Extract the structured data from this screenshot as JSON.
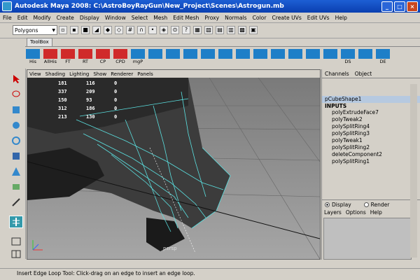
{
  "window": {
    "title": "Autodesk Maya 2008: C:\\AstroBoyRayGun\\New_Project\\Scenes\\Astrogun.mb"
  },
  "menubar": [
    "File",
    "Edit",
    "Modify",
    "Create",
    "Display",
    "Window",
    "Select",
    "Mesh",
    "Edit Mesh",
    "Proxy",
    "Normals",
    "Color",
    "Create UVs",
    "Edit UVs",
    "Help"
  ],
  "mode_select": {
    "value": "Polygons"
  },
  "shelf_tab": "ToolBox",
  "shelf_buttons": [
    {
      "label": "His",
      "color": "#1e7fc8"
    },
    {
      "label": "AllHis",
      "color": "#d02a2a"
    },
    {
      "label": "FT",
      "color": "#d02a2a"
    },
    {
      "label": "RT",
      "color": "#d02a2a"
    },
    {
      "label": "CP",
      "color": "#d02a2a"
    },
    {
      "label": "CPD",
      "color": "#d02a2a"
    },
    {
      "label": "mgP",
      "color": "#1e7fc8"
    },
    {
      "label": "",
      "color": "#1e7fc8"
    },
    {
      "label": "",
      "color": "#1e7fc8"
    },
    {
      "label": "",
      "color": "#1e7fc8"
    },
    {
      "label": "",
      "color": "#1e7fc8"
    },
    {
      "label": "",
      "color": "#1e7fc8"
    },
    {
      "label": "",
      "color": "#1e7fc8"
    },
    {
      "label": "",
      "color": "#1e7fc8"
    },
    {
      "label": "",
      "color": "#1e7fc8"
    },
    {
      "label": "",
      "color": "#1e7fc8"
    },
    {
      "label": "",
      "color": "#1e7fc8"
    },
    {
      "label": "",
      "color": "#1e7fc8"
    },
    {
      "label": "DS",
      "color": "#1e7fc8"
    },
    {
      "label": "",
      "color": "#1e7fc8"
    },
    {
      "label": "DE",
      "color": "#1e7fc8"
    }
  ],
  "viewport": {
    "menu": [
      "View",
      "Shading",
      "Lighting",
      "Show",
      "Renderer",
      "Panels"
    ],
    "hud_rows": [
      [
        "181",
        "116",
        "0"
      ],
      [
        "337",
        "209",
        "0"
      ],
      [
        "150",
        "93",
        "0"
      ],
      [
        "312",
        "186",
        "0"
      ],
      [
        "213",
        "130",
        "0"
      ]
    ],
    "camera_label": "persp"
  },
  "channel_box": {
    "tabs": [
      "Channels",
      "Object"
    ],
    "shape_node": "pCubeShape1",
    "inputs_label": "INPUTS",
    "history": [
      "polyExtrudeFace7",
      "polyTweak2",
      "polySplitRing4",
      "polySplitRing3",
      "polyTweak1",
      "polySplitRing2",
      "deleteComponent2",
      "polySplitRing1"
    ]
  },
  "layer_editor": {
    "display_label": "Display",
    "render_label": "Render",
    "menu": [
      "Layers",
      "Options",
      "Help"
    ]
  },
  "status": {
    "help_line": "Insert Edge Loop Tool: Click-drag on an edge to insert an edge loop."
  },
  "colors": {
    "title_bar": "#0a3fb0",
    "viewport_bg": "#8f8f8f",
    "wire": "#5ae0e0"
  }
}
